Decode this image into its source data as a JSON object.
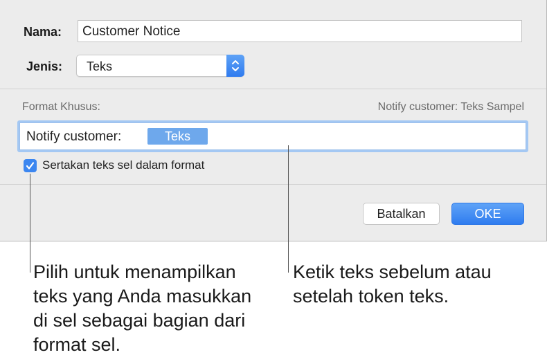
{
  "dialog": {
    "name_label": "Nama:",
    "name_value": "Customer Notice",
    "type_label": "Jenis:",
    "type_value": "Teks",
    "custom_format_label": "Format Khusus:",
    "preview": "Notify customer: Teks Sampel",
    "format_prefix": "Notify customer:",
    "token_label": "Teks",
    "checkbox_checked": true,
    "checkbox_label": "Sertakan teks sel dalam format",
    "cancel_label": "Batalkan",
    "ok_label": "OKE"
  },
  "callouts": {
    "left": "Pilih untuk menampilkan\nteks yang Anda masukkan\ndi sel sebagai bagian dari\nformat sel.",
    "right": "Ketik teks sebelum atau\nsetelah token teks."
  },
  "colors": {
    "accent": "#3b86f0",
    "token": "#6ea8ec",
    "dialog_bg": "#ececec"
  }
}
